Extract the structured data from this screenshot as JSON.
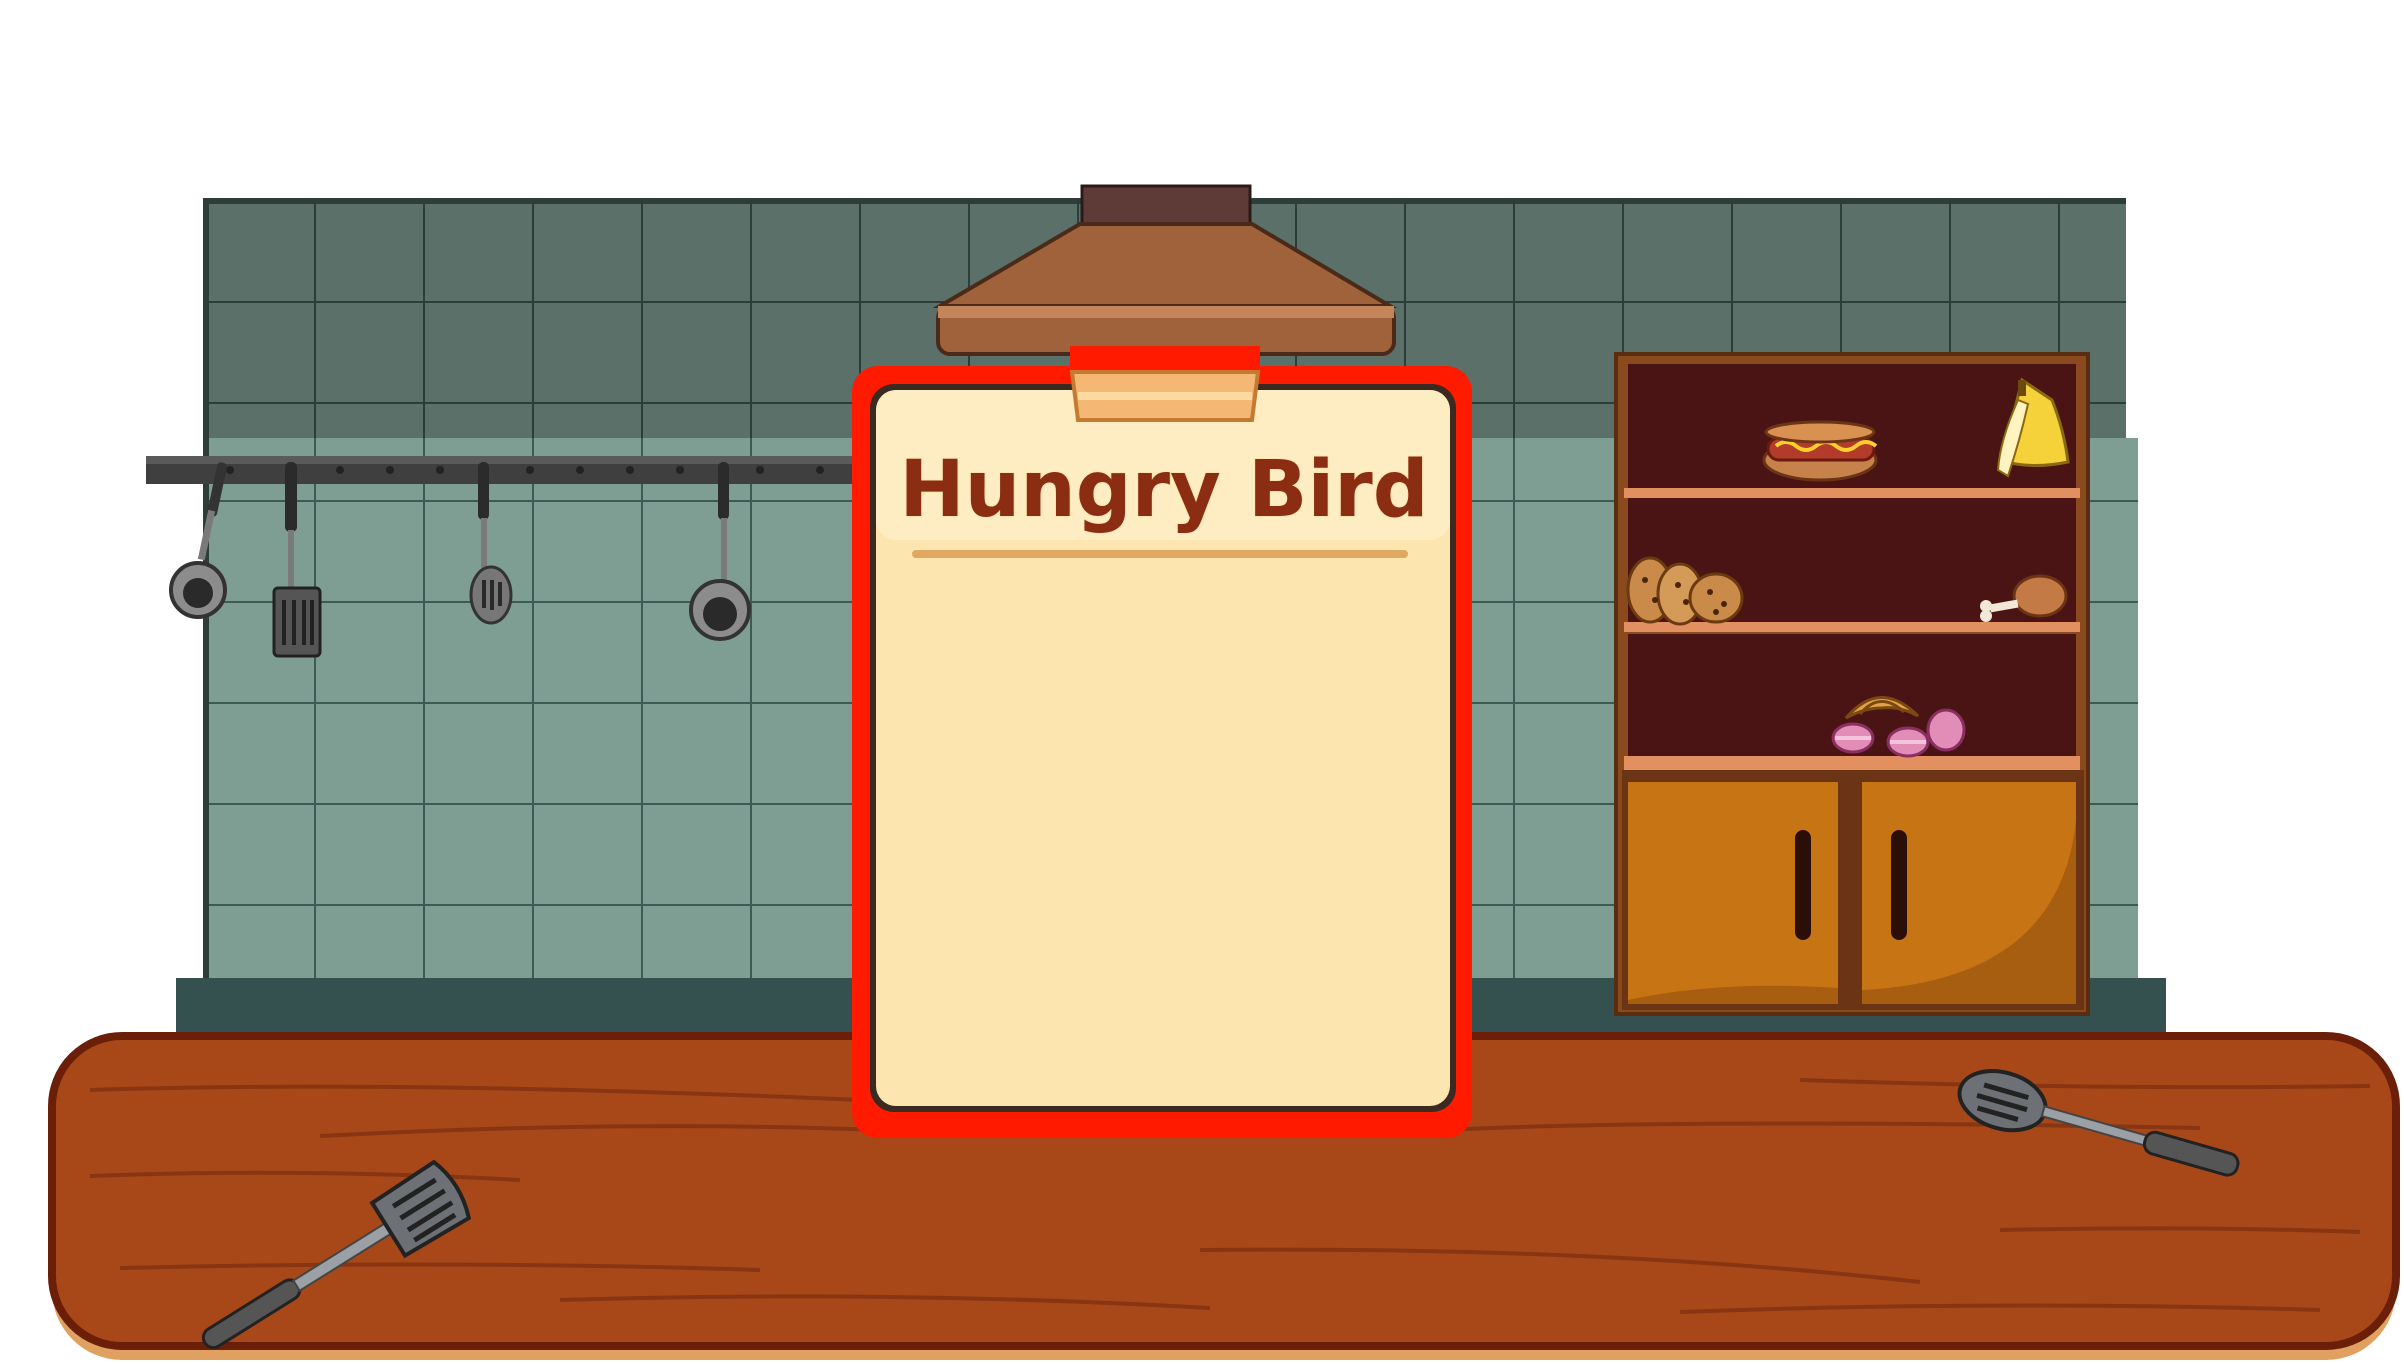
{
  "game": {
    "title": "Hungry Bird"
  },
  "scene": {
    "wall_tile_dark": "#5a7068",
    "wall_tile_light": "#7f9e93",
    "grout": "#2c3d3a",
    "counter": "#a84818",
    "counter_edge": "#6b1f08",
    "clipboard_frame": "#ff1a00",
    "clipboard_paper": "#fde5b0",
    "title_color": "#8a2d12",
    "hood": "#a0623a",
    "shelf_wood": "#8a4a1e",
    "shelf_back": "#4a1414",
    "cabinet": "#c77414"
  },
  "shelf_items": [
    "hotdog-icon",
    "banana-icon",
    "cookies-icon",
    "chicken-leg-icon",
    "croissant-icon",
    "macarons-icon"
  ],
  "utensils": [
    "ladle-icon",
    "slotted-turner-icon",
    "whisk-spoon-icon",
    "ladle-icon",
    "spatula-icon",
    "slotted-spoon-icon"
  ]
}
